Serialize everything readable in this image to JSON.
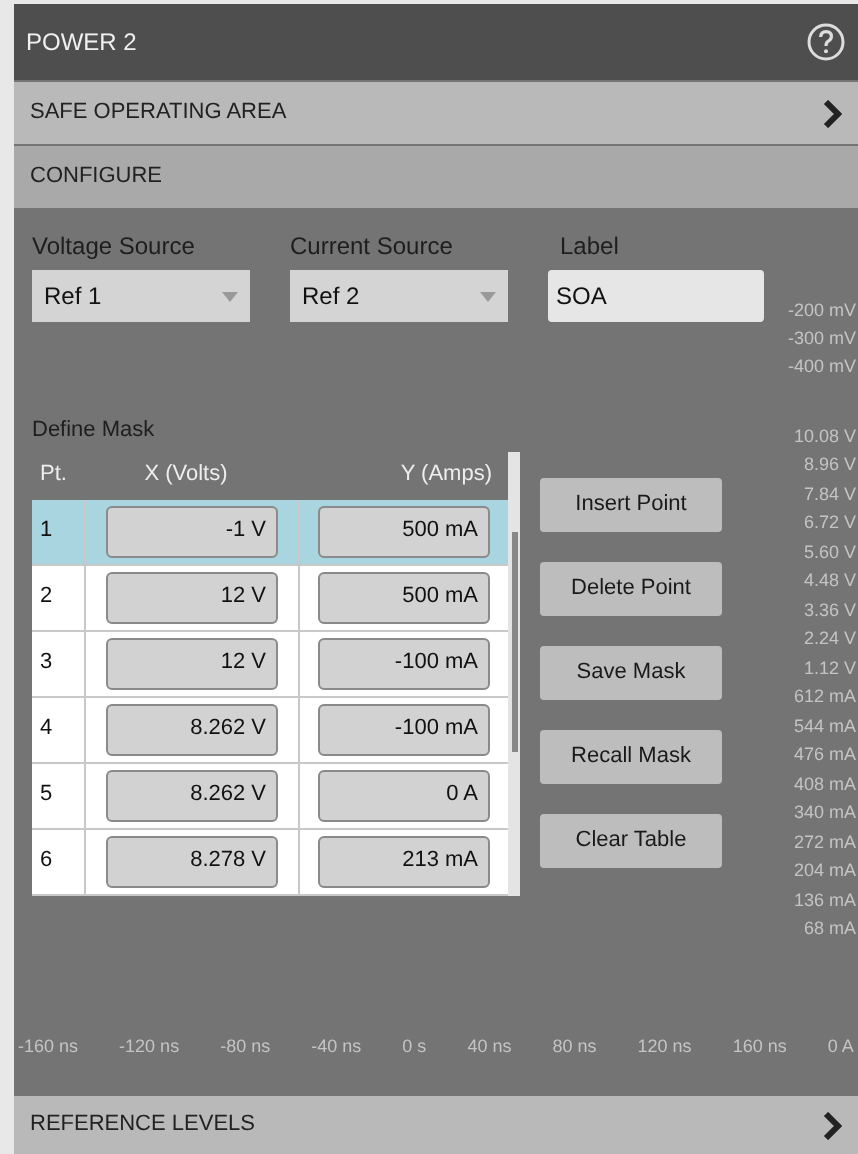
{
  "title": "POWER 2",
  "sections": [
    {
      "label": "SAFE OPERATING AREA",
      "kind": "link"
    },
    {
      "label": "CONFIGURE",
      "kind": "header"
    }
  ],
  "sources": [
    {
      "label": "Voltage Source",
      "kind": "dropdown",
      "value": "Ref 1"
    },
    {
      "label": "Current Source",
      "kind": "dropdown",
      "value": "Ref 2"
    },
    {
      "label": "Label",
      "kind": "text",
      "value": "SOA"
    }
  ],
  "mask": {
    "title": "Define Mask",
    "columns": [
      "Pt.",
      "X (Volts)",
      "Y (Amps)"
    ],
    "rows": [
      {
        "pt": "1",
        "x": "-1 V",
        "y": "500 mA",
        "selected": true
      },
      {
        "pt": "2",
        "x": "12 V",
        "y": "500 mA",
        "selected": false
      },
      {
        "pt": "3",
        "x": "12 V",
        "y": "-100 mA",
        "selected": false
      },
      {
        "pt": "4",
        "x": "8.262 V",
        "y": "-100 mA",
        "selected": false
      },
      {
        "pt": "5",
        "x": "8.262 V",
        "y": "0 A",
        "selected": false
      },
      {
        "pt": "6",
        "x": "8.278 V",
        "y": "213 mA",
        "selected": false
      }
    ]
  },
  "buttons": [
    "Insert Point",
    "Delete Point",
    "Save Mask",
    "Recall Mask",
    "Clear Table"
  ],
  "background_scope": {
    "upper_labels": [
      "-200 mV",
      "-300 mV",
      "-400 mV"
    ],
    "y_labels": [
      "10.08 V",
      "8.96 V",
      "7.84 V",
      "6.72 V",
      "5.60 V",
      "4.48 V",
      "3.36 V",
      "2.24 V",
      "1.12 V",
      "612 mA",
      "544 mA",
      "476 mA",
      "408 mA",
      "340 mA",
      "272 mA",
      "204 mA",
      "136 mA",
      "68 mA"
    ],
    "x_labels": [
      "-160 ns",
      "-120 ns",
      "-80 ns",
      "-40 ns",
      "0 s",
      "40 ns",
      "80 ns",
      "120 ns",
      "160 ns",
      "0 A"
    ]
  },
  "footer": {
    "label": "REFERENCE LEVELS"
  }
}
